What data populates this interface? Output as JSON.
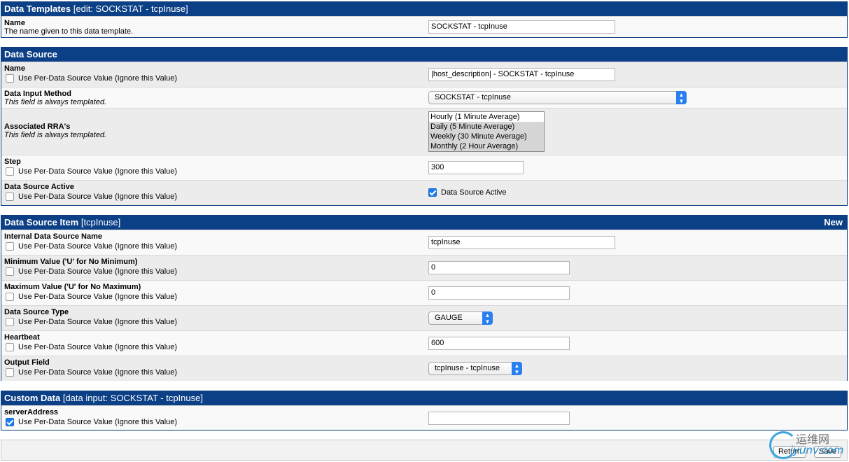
{
  "templates": {
    "title": "Data Templates",
    "subtitle": "[edit: SOCKSTAT - tcpInuse]",
    "name_label": "Name",
    "name_desc": "The name given to this data template.",
    "name_value": "SOCKSTAT - tcpInuse"
  },
  "source": {
    "title": "Data Source",
    "per_ds_label": "Use Per-Data Source Value (Ignore this Value)",
    "always_templated": "This field is always templated.",
    "name_label": "Name",
    "name_value": "|host_description| - SOCKSTAT - tcpInuse",
    "input_method_label": "Data Input Method",
    "input_method_value": "SOCKSTAT - tcpInuse",
    "rra_label": "Associated RRA's",
    "rra_options": [
      "Hourly (1 Minute Average)",
      "Daily (5 Minute Average)",
      "Weekly (30 Minute Average)",
      "Monthly (2 Hour Average)"
    ],
    "step_label": "Step",
    "step_value": "300",
    "active_label": "Data Source Active",
    "active_checkbox_label": "Data Source Active"
  },
  "item": {
    "title": "Data Source Item",
    "subtitle": "[tcpInuse]",
    "new_label": "New",
    "internal_name_label": "Internal Data Source Name",
    "internal_name_value": "tcpInuse",
    "min_label": "Minimum Value ('U' for No Minimum)",
    "min_value": "0",
    "max_label": "Maximum Value ('U' for No Maximum)",
    "max_value": "0",
    "type_label": "Data Source Type",
    "type_value": "GAUGE",
    "heartbeat_label": "Heartbeat",
    "heartbeat_value": "600",
    "output_label": "Output Field",
    "output_value": "tcpInuse - tcpInuse"
  },
  "custom": {
    "title": "Custom Data",
    "subtitle": "[data input: SOCKSTAT - tcpInuse]",
    "server_label": "serverAddress",
    "server_value": ""
  },
  "footer": {
    "return_label": "Return",
    "save_label": "Save"
  },
  "watermark": {
    "cn": "运维网",
    "en": "iyunv.com"
  },
  "colors": {
    "header_bg": "#0b3f86",
    "accent": "#1b7cf0"
  }
}
